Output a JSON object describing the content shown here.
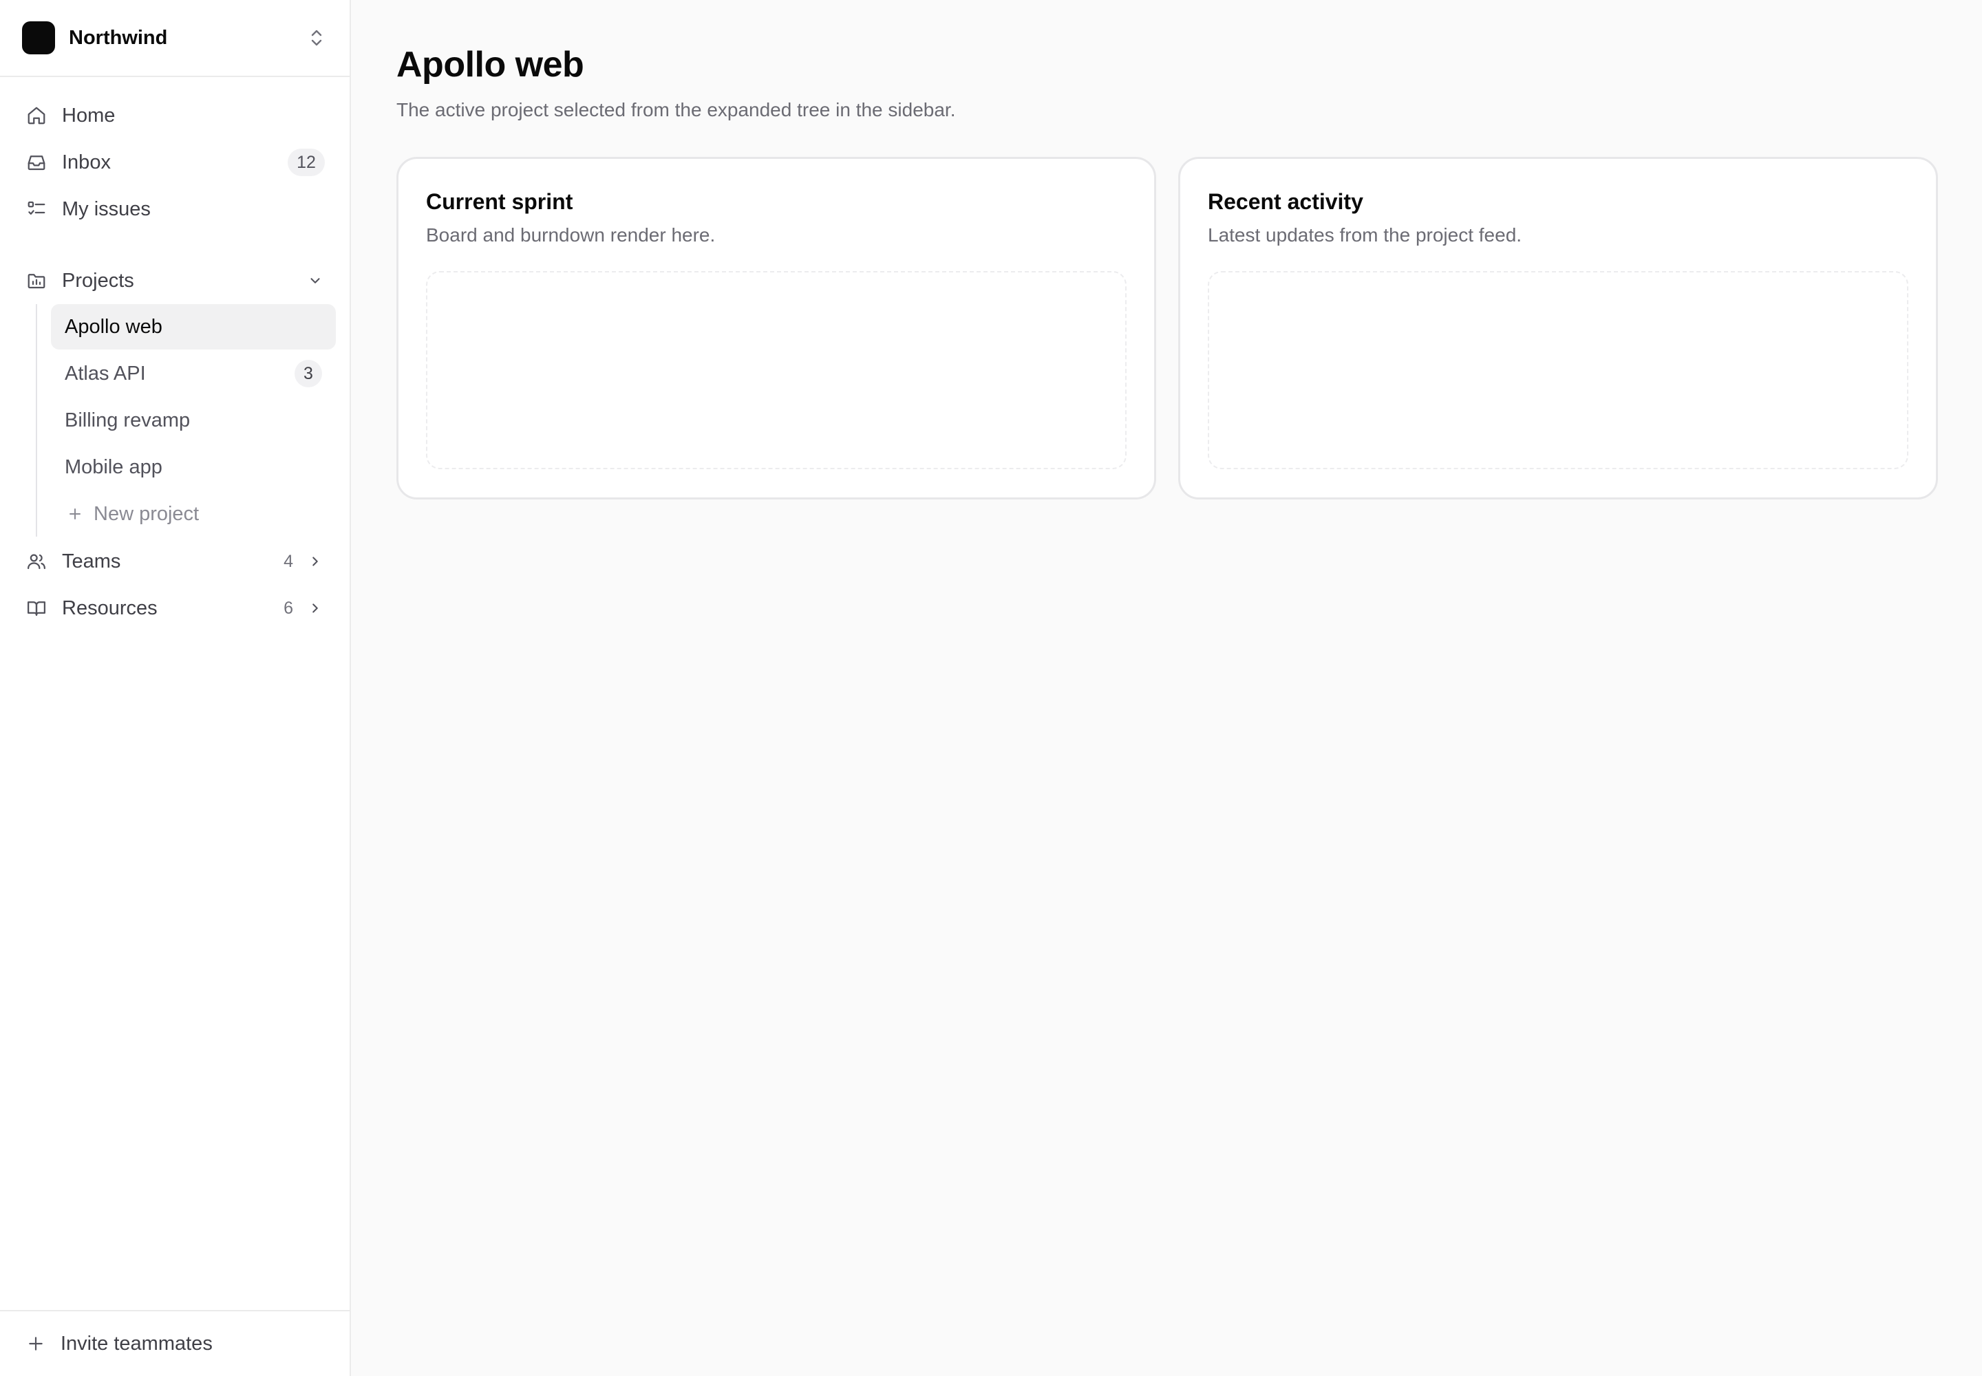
{
  "workspace": {
    "name": "Northwind"
  },
  "nav": {
    "home": {
      "label": "Home"
    },
    "inbox": {
      "label": "Inbox",
      "badge": "12"
    },
    "my_issues": {
      "label": "My issues"
    }
  },
  "projects": {
    "label": "Projects",
    "items": [
      {
        "label": "Apollo web",
        "active": true
      },
      {
        "label": "Atlas API",
        "badge": "3"
      },
      {
        "label": "Billing revamp"
      },
      {
        "label": "Mobile app"
      }
    ],
    "new_label": "New project"
  },
  "teams": {
    "label": "Teams",
    "count": "4"
  },
  "resources": {
    "label": "Resources",
    "count": "6"
  },
  "footer": {
    "invite_label": "Invite teammates"
  },
  "main": {
    "title": "Apollo web",
    "subtitle": "The active project selected from the expanded tree in the sidebar.",
    "cards": [
      {
        "title": "Current sprint",
        "desc": "Board and burndown render here."
      },
      {
        "title": "Recent activity",
        "desc": "Latest updates from the project feed."
      }
    ]
  }
}
